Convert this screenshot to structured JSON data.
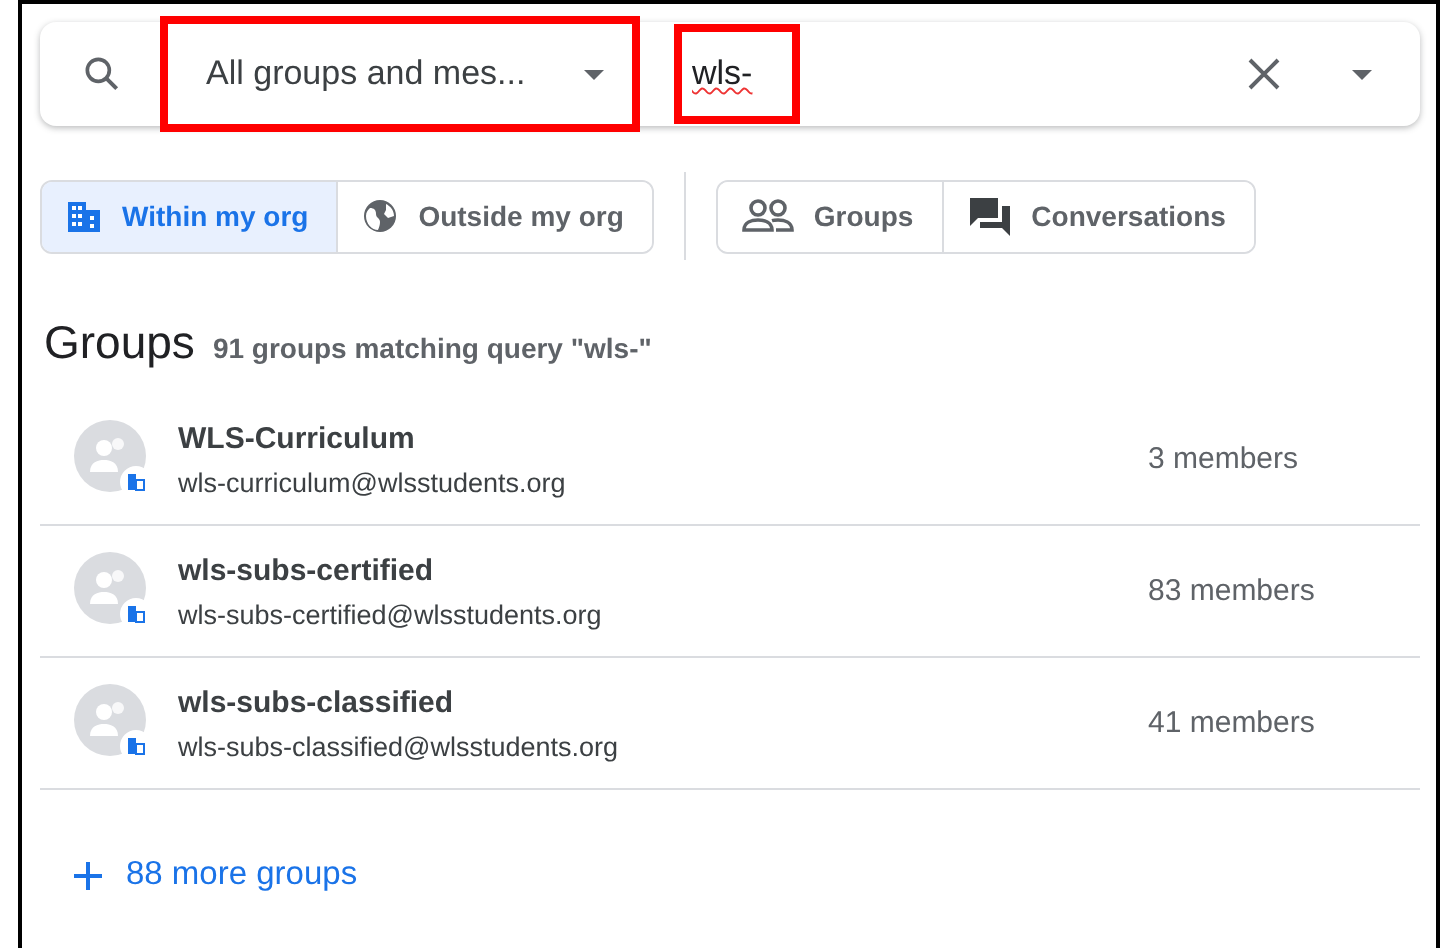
{
  "search": {
    "scope": {
      "value": "All groups and mes...",
      "highlighted": true
    },
    "query": {
      "value": "wls-",
      "highlighted": true
    }
  },
  "filters": [
    [
      {
        "label": "Within my org",
        "kind": "building",
        "selected": true
      },
      {
        "label": "Outside my org",
        "kind": "globe",
        "selected": false
      }
    ],
    [
      {
        "label": "Groups",
        "kind": "people",
        "selected": false
      },
      {
        "label": "Conversations",
        "kind": "chat",
        "selected": false
      }
    ]
  ],
  "results": {
    "title": "Groups",
    "summary": "91 groups matching query \"wls-\"",
    "rows": [
      {
        "name": "WLS-Curriculum",
        "email": "wls-curriculum@wlsstudents.org",
        "members": "3 members"
      },
      {
        "name": "wls-subs-certified",
        "email": "wls-subs-certified@wlsstudents.org",
        "members": "83 members"
      },
      {
        "name": "wls-subs-classified",
        "email": "wls-subs-classified@wlsstudents.org",
        "members": "41 members"
      }
    ],
    "more": "88 more groups"
  }
}
